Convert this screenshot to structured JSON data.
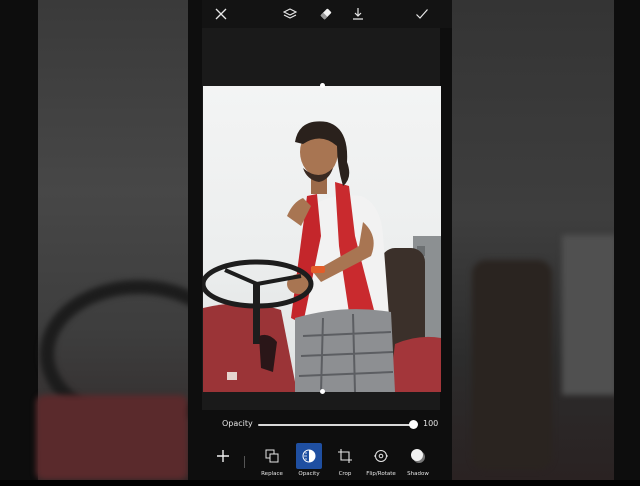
{
  "topbar": {
    "icons": [
      "close-icon",
      "layers-icon",
      "eraser-icon",
      "download-icon",
      "checkmark-icon"
    ]
  },
  "opacity": {
    "label": "Opacity",
    "value": "100",
    "level": 1.0
  },
  "toolbar": {
    "add_icon": "plus-icon",
    "tools": [
      {
        "label": "Replace",
        "icon": "replace-icon"
      },
      {
        "label": "Opacity",
        "icon": "opacity-icon",
        "active": true
      },
      {
        "label": "Crop",
        "icon": "crop-icon"
      },
      {
        "label": "Flip/Rotate",
        "icon": "flip-rotate-icon"
      },
      {
        "label": "Shadow",
        "icon": "shadow-icon"
      }
    ]
  },
  "colors": {
    "accent": "#1f4fa1",
    "background": "#0e0e0e"
  }
}
